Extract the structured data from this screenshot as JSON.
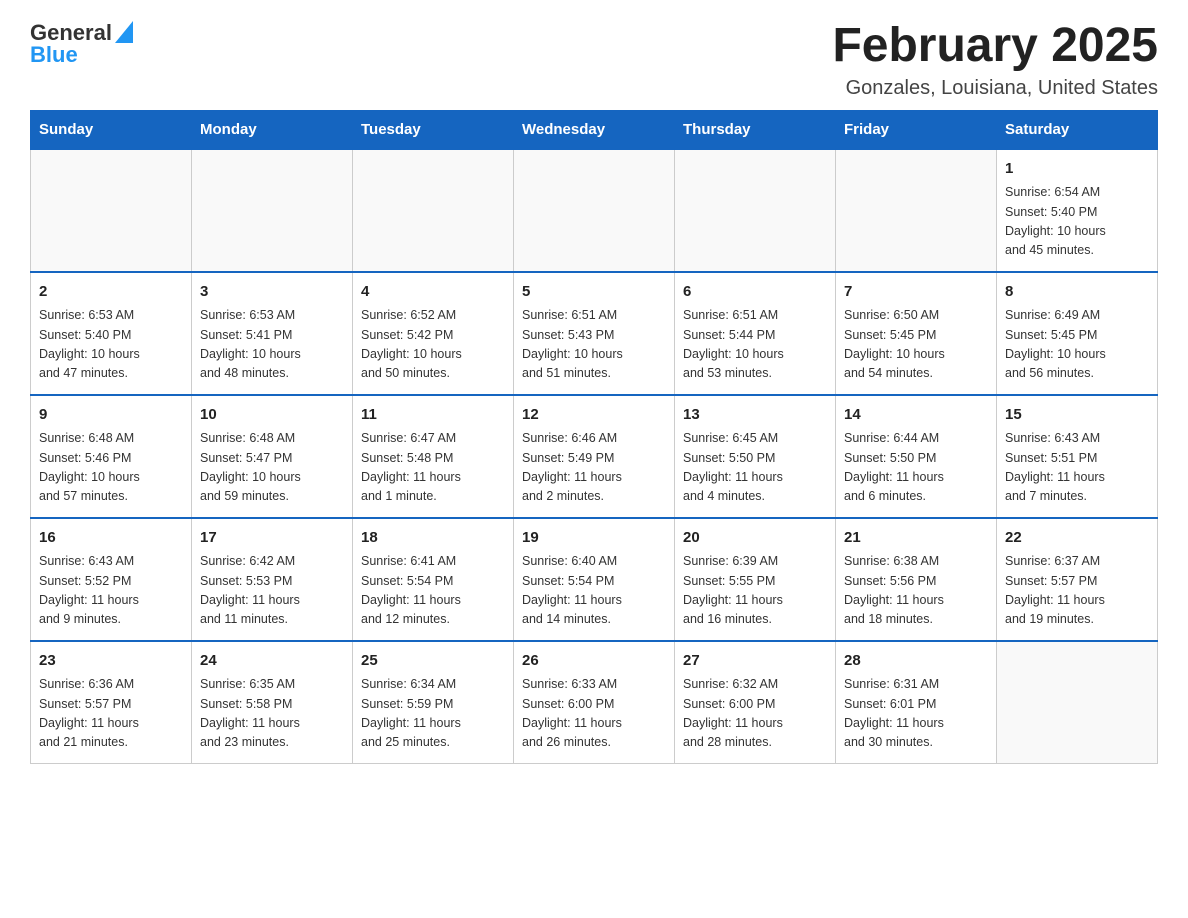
{
  "header": {
    "logo_general": "General",
    "logo_blue": "Blue",
    "month_year": "February 2025",
    "location": "Gonzales, Louisiana, United States"
  },
  "weekdays": [
    "Sunday",
    "Monday",
    "Tuesday",
    "Wednesday",
    "Thursday",
    "Friday",
    "Saturday"
  ],
  "weeks": [
    [
      {
        "day": "",
        "info": ""
      },
      {
        "day": "",
        "info": ""
      },
      {
        "day": "",
        "info": ""
      },
      {
        "day": "",
        "info": ""
      },
      {
        "day": "",
        "info": ""
      },
      {
        "day": "",
        "info": ""
      },
      {
        "day": "1",
        "info": "Sunrise: 6:54 AM\nSunset: 5:40 PM\nDaylight: 10 hours\nand 45 minutes."
      }
    ],
    [
      {
        "day": "2",
        "info": "Sunrise: 6:53 AM\nSunset: 5:40 PM\nDaylight: 10 hours\nand 47 minutes."
      },
      {
        "day": "3",
        "info": "Sunrise: 6:53 AM\nSunset: 5:41 PM\nDaylight: 10 hours\nand 48 minutes."
      },
      {
        "day": "4",
        "info": "Sunrise: 6:52 AM\nSunset: 5:42 PM\nDaylight: 10 hours\nand 50 minutes."
      },
      {
        "day": "5",
        "info": "Sunrise: 6:51 AM\nSunset: 5:43 PM\nDaylight: 10 hours\nand 51 minutes."
      },
      {
        "day": "6",
        "info": "Sunrise: 6:51 AM\nSunset: 5:44 PM\nDaylight: 10 hours\nand 53 minutes."
      },
      {
        "day": "7",
        "info": "Sunrise: 6:50 AM\nSunset: 5:45 PM\nDaylight: 10 hours\nand 54 minutes."
      },
      {
        "day": "8",
        "info": "Sunrise: 6:49 AM\nSunset: 5:45 PM\nDaylight: 10 hours\nand 56 minutes."
      }
    ],
    [
      {
        "day": "9",
        "info": "Sunrise: 6:48 AM\nSunset: 5:46 PM\nDaylight: 10 hours\nand 57 minutes."
      },
      {
        "day": "10",
        "info": "Sunrise: 6:48 AM\nSunset: 5:47 PM\nDaylight: 10 hours\nand 59 minutes."
      },
      {
        "day": "11",
        "info": "Sunrise: 6:47 AM\nSunset: 5:48 PM\nDaylight: 11 hours\nand 1 minute."
      },
      {
        "day": "12",
        "info": "Sunrise: 6:46 AM\nSunset: 5:49 PM\nDaylight: 11 hours\nand 2 minutes."
      },
      {
        "day": "13",
        "info": "Sunrise: 6:45 AM\nSunset: 5:50 PM\nDaylight: 11 hours\nand 4 minutes."
      },
      {
        "day": "14",
        "info": "Sunrise: 6:44 AM\nSunset: 5:50 PM\nDaylight: 11 hours\nand 6 minutes."
      },
      {
        "day": "15",
        "info": "Sunrise: 6:43 AM\nSunset: 5:51 PM\nDaylight: 11 hours\nand 7 minutes."
      }
    ],
    [
      {
        "day": "16",
        "info": "Sunrise: 6:43 AM\nSunset: 5:52 PM\nDaylight: 11 hours\nand 9 minutes."
      },
      {
        "day": "17",
        "info": "Sunrise: 6:42 AM\nSunset: 5:53 PM\nDaylight: 11 hours\nand 11 minutes."
      },
      {
        "day": "18",
        "info": "Sunrise: 6:41 AM\nSunset: 5:54 PM\nDaylight: 11 hours\nand 12 minutes."
      },
      {
        "day": "19",
        "info": "Sunrise: 6:40 AM\nSunset: 5:54 PM\nDaylight: 11 hours\nand 14 minutes."
      },
      {
        "day": "20",
        "info": "Sunrise: 6:39 AM\nSunset: 5:55 PM\nDaylight: 11 hours\nand 16 minutes."
      },
      {
        "day": "21",
        "info": "Sunrise: 6:38 AM\nSunset: 5:56 PM\nDaylight: 11 hours\nand 18 minutes."
      },
      {
        "day": "22",
        "info": "Sunrise: 6:37 AM\nSunset: 5:57 PM\nDaylight: 11 hours\nand 19 minutes."
      }
    ],
    [
      {
        "day": "23",
        "info": "Sunrise: 6:36 AM\nSunset: 5:57 PM\nDaylight: 11 hours\nand 21 minutes."
      },
      {
        "day": "24",
        "info": "Sunrise: 6:35 AM\nSunset: 5:58 PM\nDaylight: 11 hours\nand 23 minutes."
      },
      {
        "day": "25",
        "info": "Sunrise: 6:34 AM\nSunset: 5:59 PM\nDaylight: 11 hours\nand 25 minutes."
      },
      {
        "day": "26",
        "info": "Sunrise: 6:33 AM\nSunset: 6:00 PM\nDaylight: 11 hours\nand 26 minutes."
      },
      {
        "day": "27",
        "info": "Sunrise: 6:32 AM\nSunset: 6:00 PM\nDaylight: 11 hours\nand 28 minutes."
      },
      {
        "day": "28",
        "info": "Sunrise: 6:31 AM\nSunset: 6:01 PM\nDaylight: 11 hours\nand 30 minutes."
      },
      {
        "day": "",
        "info": ""
      }
    ]
  ]
}
